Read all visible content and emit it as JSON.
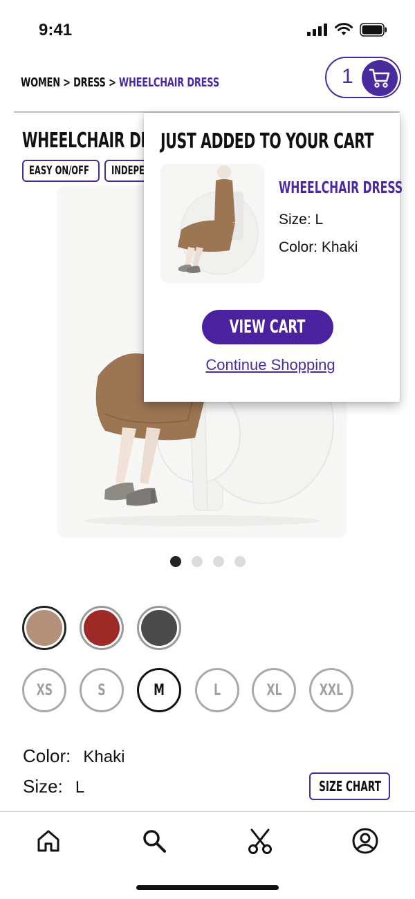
{
  "status_bar": {
    "time": "9:41"
  },
  "breadcrumb": {
    "level1": "WOMEN",
    "sep1": " > ",
    "level2": "DRESS",
    "sep2": " > ",
    "current": "WHEELCHAIR DRESS"
  },
  "cart": {
    "count": "1"
  },
  "product": {
    "title": "WHEELCHAIR DRESS",
    "tags": [
      "EASY ON/OFF",
      "INDEPENDENT"
    ]
  },
  "carousel": {
    "total": 4,
    "active_index": 0
  },
  "swatches": [
    {
      "name": "Khaki",
      "color": "#b3917a",
      "selected": true
    },
    {
      "name": "Red",
      "color": "#9e2a27",
      "selected": false
    },
    {
      "name": "Charcoal",
      "color": "#4a4a4a",
      "selected": false
    }
  ],
  "sizes": [
    {
      "label": "XS",
      "selected": false
    },
    {
      "label": "S",
      "selected": false
    },
    {
      "label": "M",
      "selected": true
    },
    {
      "label": "L",
      "selected": false
    },
    {
      "label": "XL",
      "selected": false
    },
    {
      "label": "XXL",
      "selected": false
    }
  ],
  "selection": {
    "color_label": "Color:",
    "color_value": "Khaki",
    "size_label": "Size:",
    "size_value": "L"
  },
  "size_chart_label": "SIZE CHART",
  "popup": {
    "title": "JUST ADDED TO YOUR CART",
    "item_name": "WHEELCHAIR DRESS",
    "size_text": "Size: L",
    "color_text": "Color: Khaki",
    "view_cart_label": "VIEW CART",
    "continue_label": "Continue Shopping"
  },
  "bottom_nav": [
    {
      "name": "home",
      "icon": "home-icon"
    },
    {
      "name": "search",
      "icon": "search-icon"
    },
    {
      "name": "alterations",
      "icon": "scissors-icon"
    },
    {
      "name": "account",
      "icon": "user-circle-icon"
    }
  ],
  "colors": {
    "accent": "#4a2a9f",
    "button": "#4a22a0"
  }
}
